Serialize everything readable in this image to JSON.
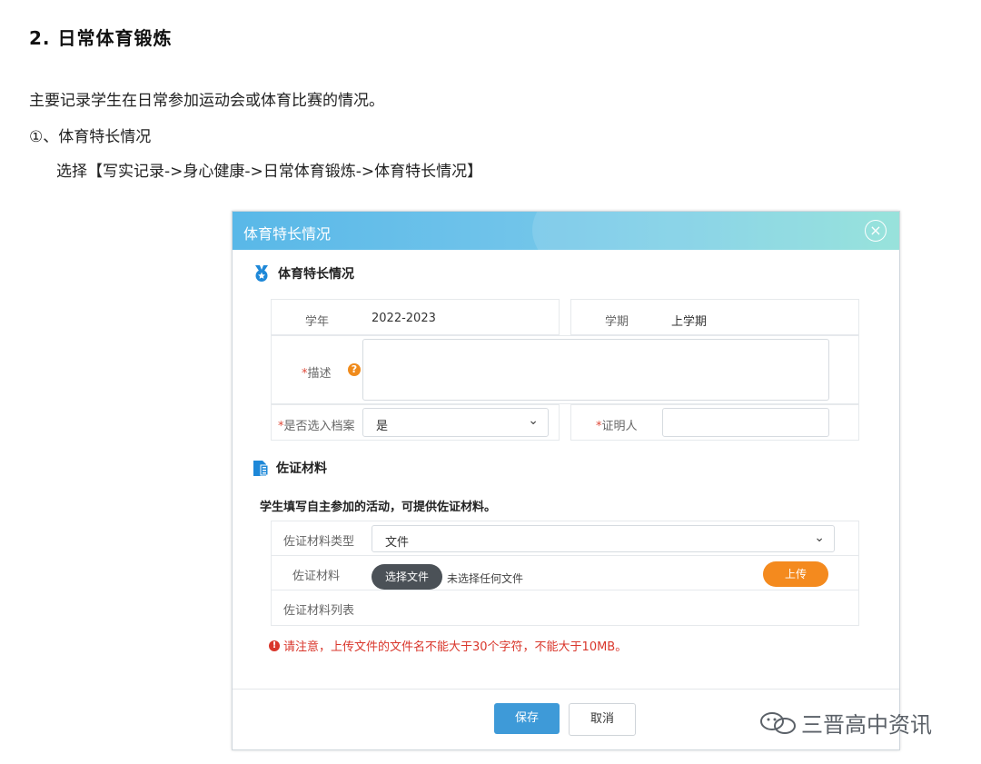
{
  "doc": {
    "heading": "2. 日常体育锻炼",
    "para1": "主要记录学生在日常参加运动会或体育比赛的情况。",
    "para2": "①、体育特长情况",
    "para3": "选择【写实记录->身心健康->日常体育锻炼->体育特长情况】"
  },
  "dialog": {
    "title": "体育特长情况",
    "close_icon": "close-circle-icon",
    "section1": {
      "title": "体育特长情况",
      "icon": "medal-icon"
    },
    "fields": {
      "year_label": "学年",
      "year_value": "2022-2023",
      "term_label": "学期",
      "term_value": "上学期",
      "desc_req": "*",
      "desc_label": "描述",
      "help_glyph": "?",
      "archive_req": "*",
      "archive_label": "是否选入档案",
      "archive_value": "是",
      "witness_req": "*",
      "witness_label": "证明人"
    },
    "section2": {
      "title": "佐证材料",
      "icon": "document-icon"
    },
    "evidence": {
      "intro": "学生填写自主参加的活动，可提供佐证材料。",
      "type_label": "佐证材料类型",
      "type_value": "文件",
      "material_label": "佐证材料",
      "choose_file": "选择文件",
      "no_file": "未选择任何文件",
      "upload": "上传",
      "list_label": "佐证材料列表"
    },
    "warning": "请注意，上传文件的文件名不能大于30个字符，不能大于10MB。",
    "buttons": {
      "save": "保存",
      "cancel": "取消"
    }
  },
  "watermark": {
    "text": "三晋高中资讯",
    "icon": "wechat-icon"
  },
  "colors": {
    "header_gradient_start": "#59b8e8",
    "header_gradient_end": "#8adfd7",
    "primary": "#3e9ad8",
    "upload": "#f48a1e",
    "warning": "#d9362b"
  }
}
